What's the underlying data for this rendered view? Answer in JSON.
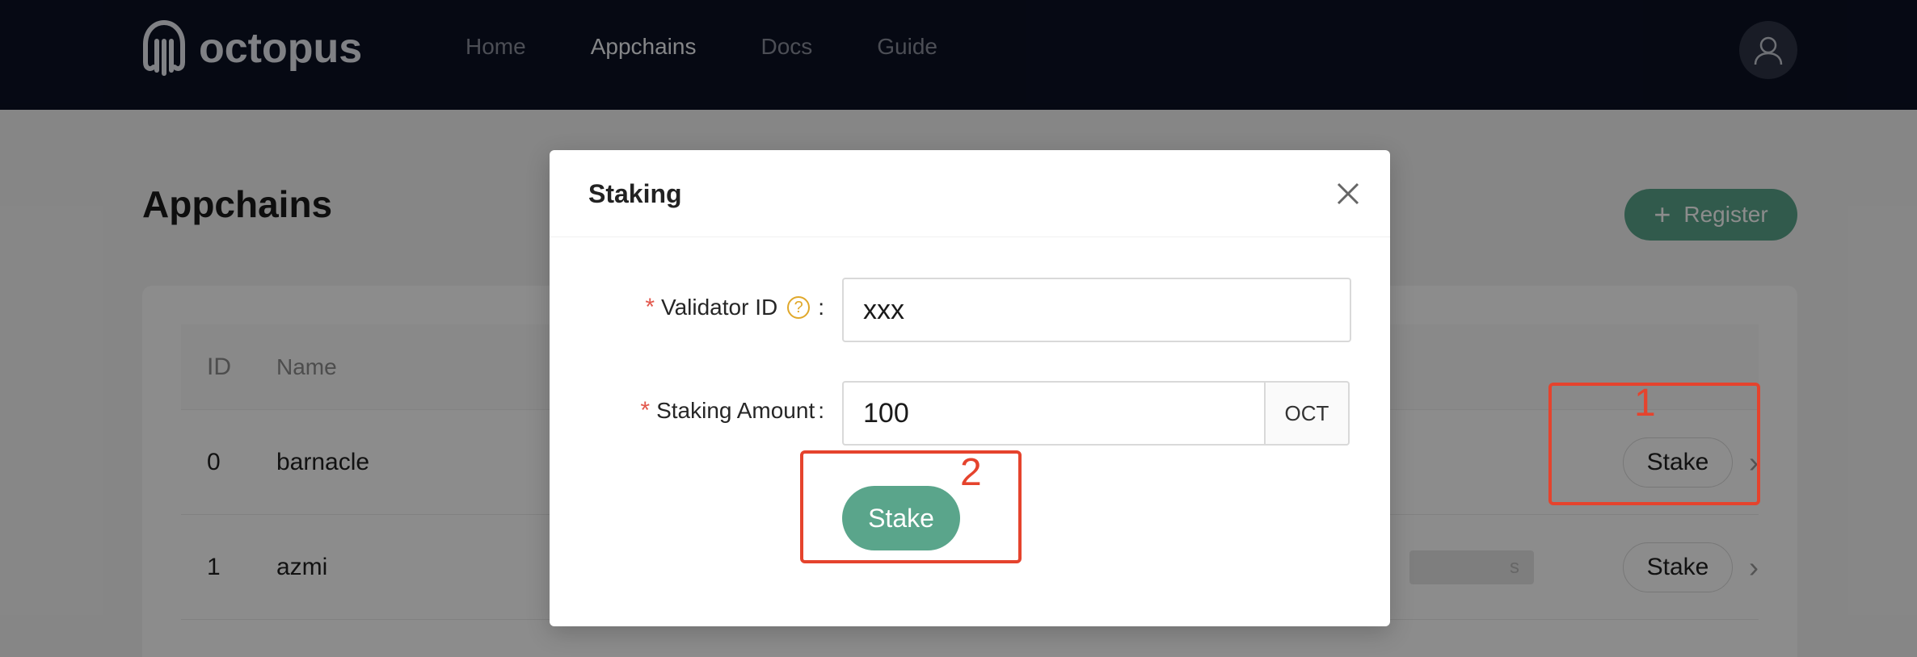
{
  "header": {
    "logo_text": "octopus",
    "nav": [
      {
        "label": "Home",
        "active": false
      },
      {
        "label": "Appchains",
        "active": true
      },
      {
        "label": "Docs",
        "active": false
      },
      {
        "label": "Guide",
        "active": false
      }
    ],
    "avatar_icon": "user-icon"
  },
  "page": {
    "title": "Appchains",
    "register_label": "Register",
    "register_icon": "plus-icon"
  },
  "table": {
    "columns": [
      "ID",
      "Name"
    ],
    "rows": [
      {
        "id": "0",
        "name": "barnacle",
        "action": "Stake"
      },
      {
        "id": "1",
        "name": "azmi",
        "action": "Stake",
        "badge": "s"
      }
    ]
  },
  "modal": {
    "title": "Staking",
    "close_icon": "close-icon",
    "validator_label": "Validator ID",
    "validator_value": "xxx",
    "help_icon": "question-circle-icon",
    "amount_label": "Staking Amount",
    "amount_value": "100",
    "amount_unit": "OCT",
    "submit_label": "Stake",
    "colon": ":",
    "required_mark": "*"
  },
  "annotations": {
    "step1": "1",
    "step2": "2",
    "color": "#e5432d"
  },
  "colors": {
    "header_bg": "#0b1124",
    "brand_green": "#5aa58b"
  }
}
